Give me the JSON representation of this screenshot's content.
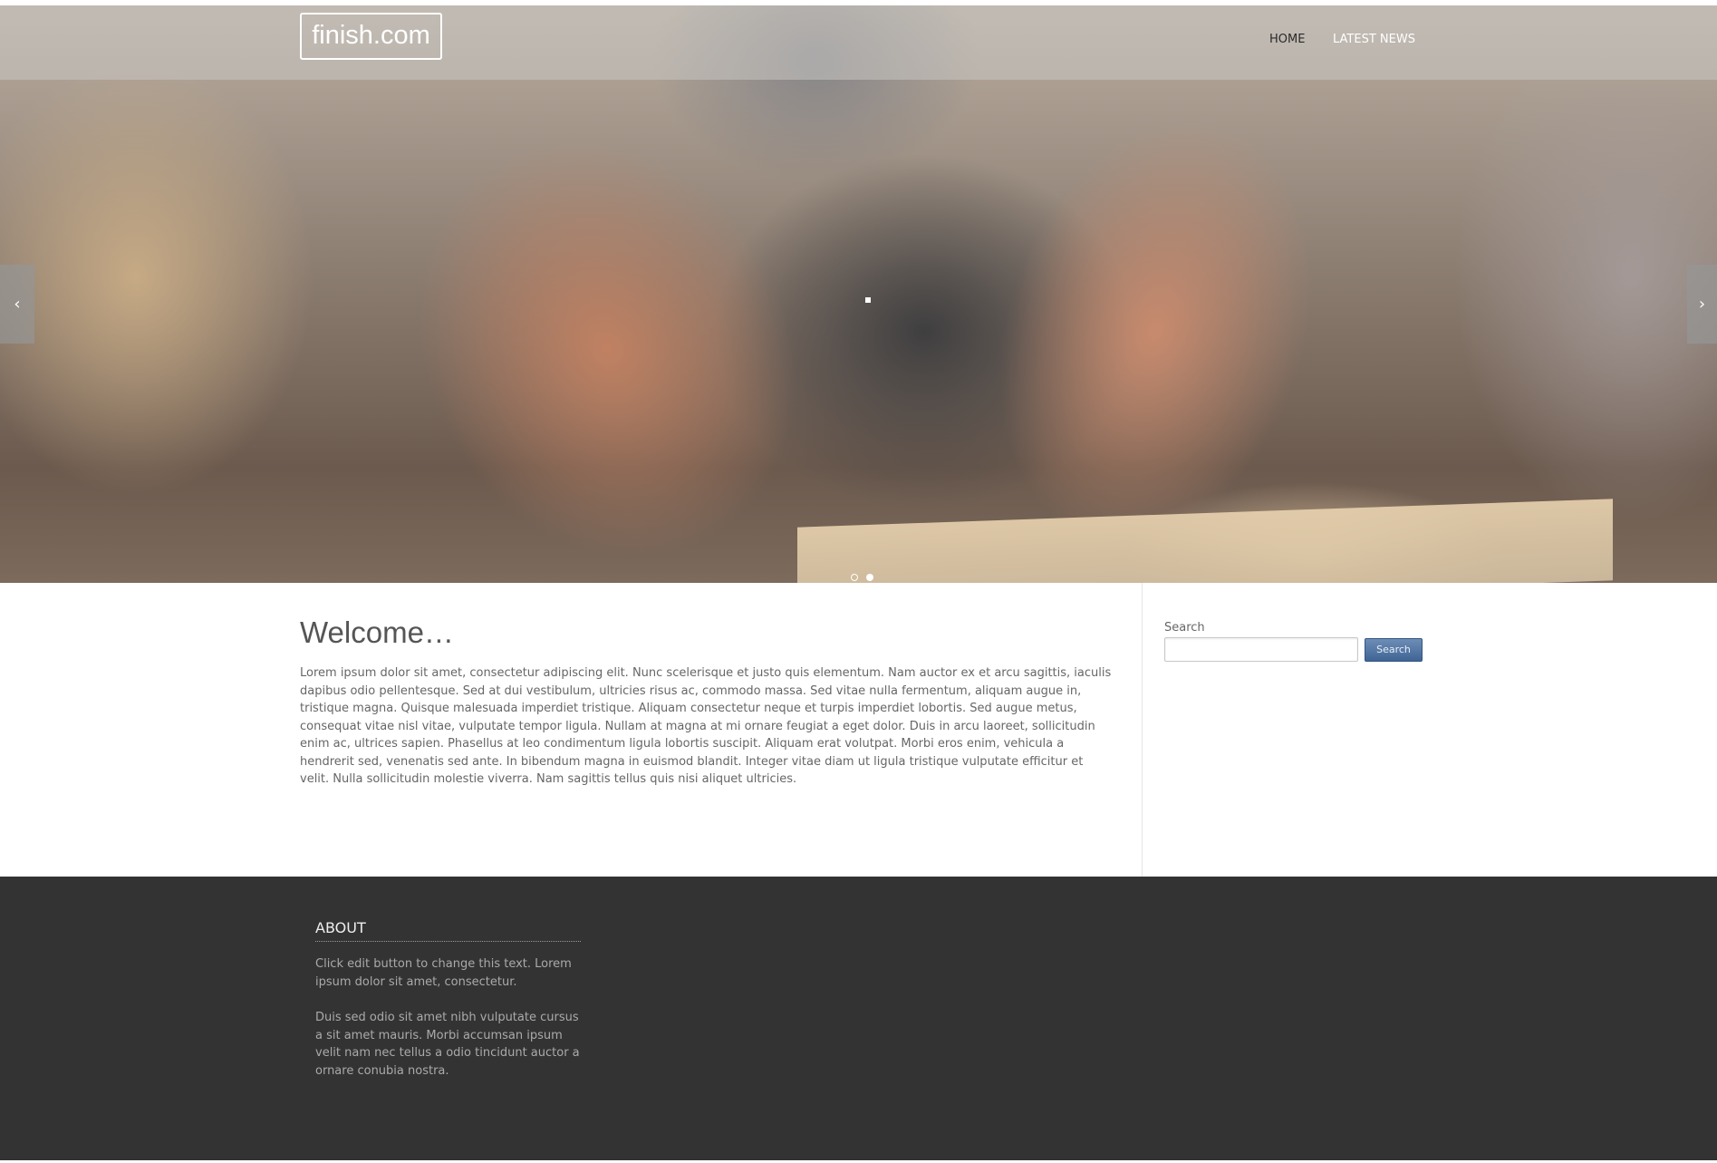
{
  "header": {
    "logo": "finish.com",
    "nav": [
      {
        "label": "HOME"
      },
      {
        "label": "LATEST NEWS"
      }
    ]
  },
  "hero": {
    "prev_icon": "chevron-left-icon",
    "next_icon": "chevron-right-icon",
    "prev_glyph": "‹",
    "next_glyph": "›",
    "slide_count": 2,
    "active_slide": 2
  },
  "main": {
    "title": "Welcome…",
    "body": "Lorem ipsum dolor sit amet, consectetur adipiscing elit. Nunc scelerisque et justo quis elementum. Nam auctor ex et arcu sagittis, iaculis dapibus odio pellentesque. Sed at dui vestibulum, ultricies risus ac, commodo massa. Sed vitae nulla fermentum, aliquam augue in, tristique magna. Quisque malesuada imperdiet tristique. Aliquam consectetur neque et turpis imperdiet lobortis. Sed augue metus, consequat vitae nisl vitae, vulputate tempor ligula. Nullam at magna at mi ornare feugiat a eget dolor. Duis in arcu laoreet, sollicitudin enim ac, ultrices sapien. Phasellus at leo condimentum ligula lobortis suscipit. Aliquam erat volutpat. Morbi eros enim, vehicula a hendrerit sed, venenatis sed ante. In bibendum magna in euismod blandit. Integer vitae diam ut ligula tristique vulputate efficitur et velit. Nulla sollicitudin molestie viverra. Nam sagittis tellus quis nisi aliquet ultricies."
  },
  "sidebar": {
    "search_label": "Search",
    "search_value": "",
    "search_button": "Search"
  },
  "footer": {
    "about_title": "ABOUT",
    "about_p1": "Click edit button to change this text. Lorem ipsum dolor sit amet, consectetur.",
    "about_p2": "Duis sed odio sit amet nibh vulputate cursus a sit amet mauris. Morbi accumsan ipsum velit nam nec tellus a odio tincidunt auctor a ornare conubia nostra."
  },
  "colors": {
    "footer_bg": "#333333",
    "button": "#4a6fa0",
    "text": "#666666"
  }
}
